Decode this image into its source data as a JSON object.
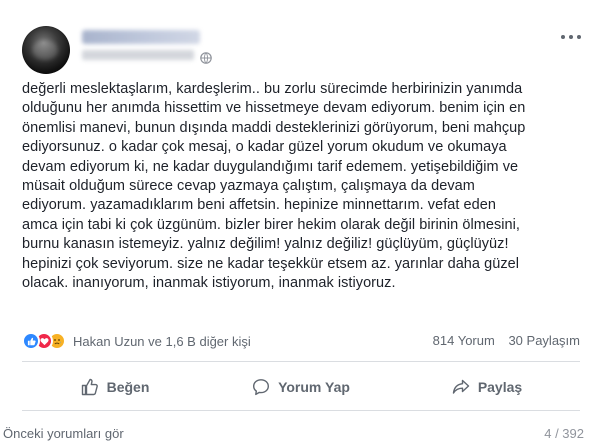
{
  "post": {
    "author": {
      "name": "",
      "time": ""
    },
    "text_lines": [
      "değerli meslektaşlarım, kardeşlerim.. bu zorlu sürecimde herbirinizin yanımda",
      "olduğunu her anımda hissettim ve hissetmeye devam ediyorum. benim için en",
      "önemlisi manevi, bunun dışında maddi desteklerinizi görüyorum, beni mahçup",
      "ediyorsunuz. o kadar çok mesaj, o kadar güzel yorum okudum ve okumaya",
      "devam ediyorum ki, ne kadar duygulandığımı tarif edemem. yetişebildiğim ve",
      "müsait olduğum sürece cevap yazmaya çalıştım, çalışmaya da devam",
      "ediyorum. yazamadıklarım beni affetsin. hepinize minnettarım. vefat eden",
      "amca için tabi ki çok üzgünüm. bizler birer hekim olarak değil birinin ölmesini,",
      "burnu kanasın istemeyiz. yalnız değilim! yalnız değiliz! güçlüyüm, güçlüyüz!",
      "hepinizi çok seviyorum. size ne kadar teşekkür etsem az. yarınlar daha güzel",
      "olacak. inanıyorum, inanmak istiyorum, inanmak istiyoruz."
    ],
    "reactions": {
      "icons": [
        "like-reaction-icon",
        "love-reaction-icon",
        "sad-reaction-icon"
      ],
      "summary": "Hakan Uzun ve 1,6 B diğer kişi",
      "comments": "814 Yorum",
      "shares": "30 Paylaşım"
    },
    "actions": {
      "like_label": "Beğen",
      "comment_label": "Yorum Yap",
      "share_label": "Paylaş"
    },
    "footer": {
      "previous_comments": "Önceki yorumları gör",
      "counter": "4 / 392"
    }
  },
  "colors": {
    "like": "#2d88ff",
    "love": "#f0284a",
    "sad": "#f7b125",
    "secondary_text": "#606770"
  }
}
